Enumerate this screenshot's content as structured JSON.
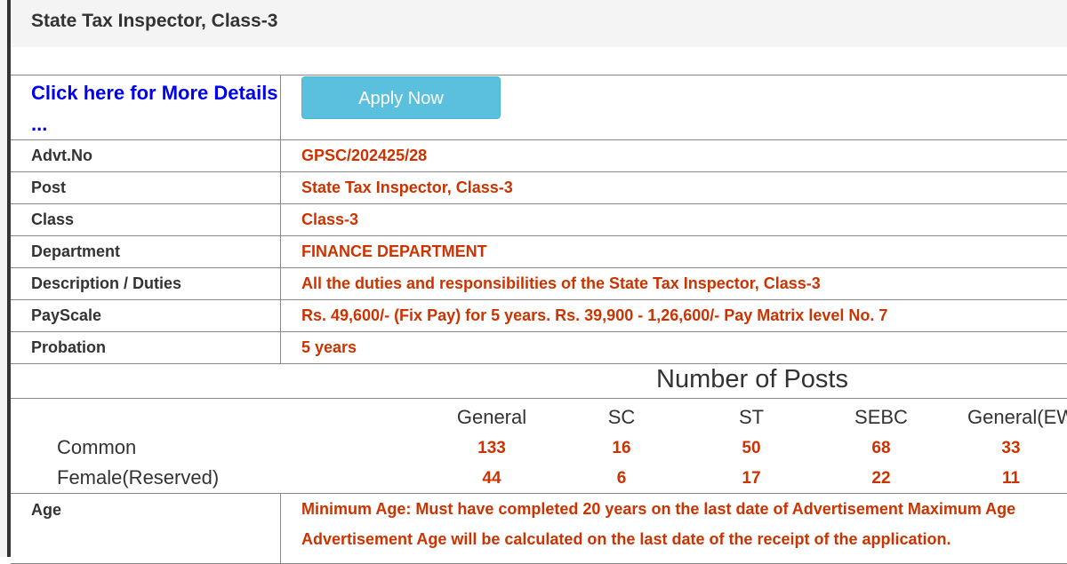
{
  "page": {
    "heading": "State Tax Inspector, Class-3"
  },
  "actions": {
    "more_details_link": "Click here for More Details ...",
    "apply_button": "Apply Now"
  },
  "details": [
    {
      "label": "Advt.No",
      "value": "GPSC/202425/28"
    },
    {
      "label": "Post",
      "value": "State Tax Inspector, Class-3"
    },
    {
      "label": "Class",
      "value": "Class-3"
    },
    {
      "label": "Department",
      "value": "FINANCE DEPARTMENT"
    },
    {
      "label": "Description / Duties",
      "value": "All the duties and responsibilities of the State Tax Inspector, Class-3"
    },
    {
      "label": "PayScale",
      "value": "Rs. 49,600/- (Fix Pay) for 5 years. Rs. 39,900 - 1,26,600/- Pay Matrix level No. 7"
    },
    {
      "label": "Probation",
      "value": "5 years"
    }
  ],
  "posts": {
    "title": "Number of Posts",
    "categories": [
      "General",
      "SC",
      "ST",
      "SEBC",
      "General(EWS)"
    ],
    "rows": [
      {
        "label": "Common",
        "values": [
          "133",
          "16",
          "50",
          "68",
          "33"
        ]
      },
      {
        "label": "Female(Reserved)",
        "values": [
          "44",
          "6",
          "17",
          "22",
          "11"
        ]
      }
    ]
  },
  "age": {
    "label": "Age",
    "line1": "Minimum Age: Must have completed 20 years on the last date of Advertisement Maximum Age",
    "line2": "Advertisement Age will be calculated on the last date of the receipt of the application."
  },
  "colors": {
    "value_text": "#cc3300",
    "link": "#0000ee",
    "button": "#5bc0de"
  }
}
